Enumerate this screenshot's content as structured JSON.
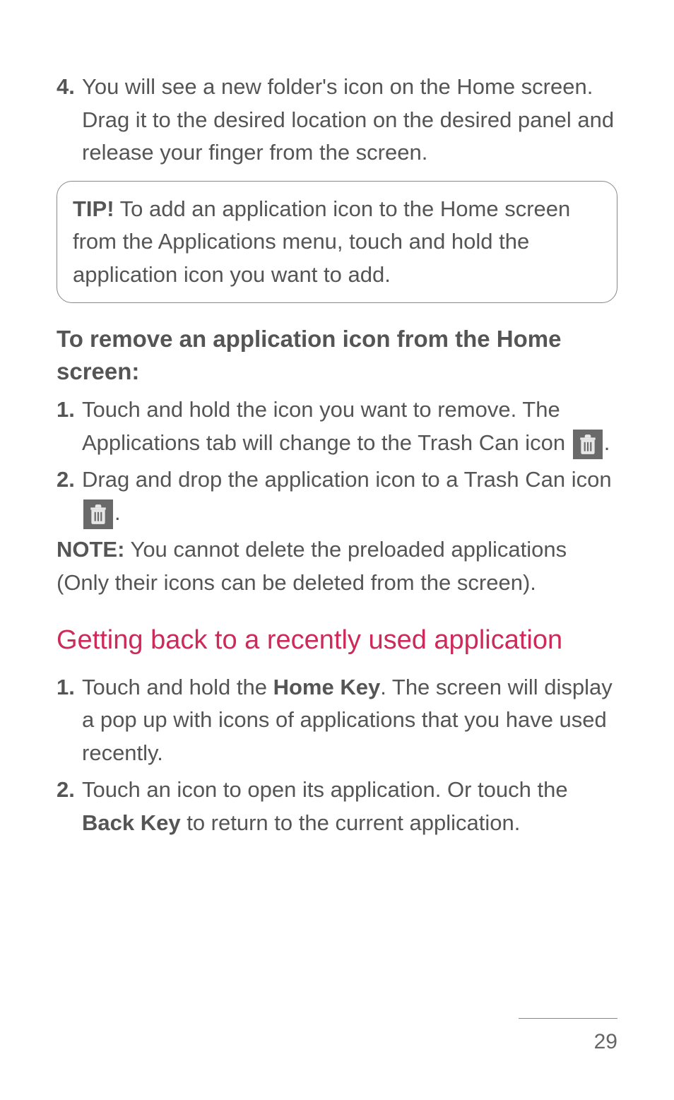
{
  "step4": {
    "num": "4.",
    "text": "You will see a new folder's icon on the Home screen. Drag it to the desired location on the desired panel and release your finger from the screen."
  },
  "tip": {
    "label": "TIP!",
    "text": " To add an application icon to the Home screen from the Applications menu, touch and hold the application icon you want to add."
  },
  "subhead1": "To remove an application icon from the Home screen:",
  "remove": {
    "step1": {
      "num": "1.",
      "pre": "Touch and hold the icon you want to remove. The Applications tab will change to the Trash Can icon ",
      "post": "."
    },
    "step2": {
      "num": "2.",
      "pre": "Drag and drop the application icon to a Trash Can icon ",
      "post": "."
    }
  },
  "note": {
    "label": "NOTE:",
    "text": " You cannot delete the preloaded applications (Only their icons can be deleted from the screen)."
  },
  "section_heading": "Getting back to a recently used application",
  "recent": {
    "step1": {
      "num": "1.",
      "pre": "Touch and hold the ",
      "bold": "Home Key",
      "post": ". The screen will display a pop up with icons of applications that you have used recently."
    },
    "step2": {
      "num": "2.",
      "pre": "Touch an icon to open its application. Or touch the ",
      "bold": "Back Key",
      "post": " to return to the current application."
    }
  },
  "page_number": "29"
}
